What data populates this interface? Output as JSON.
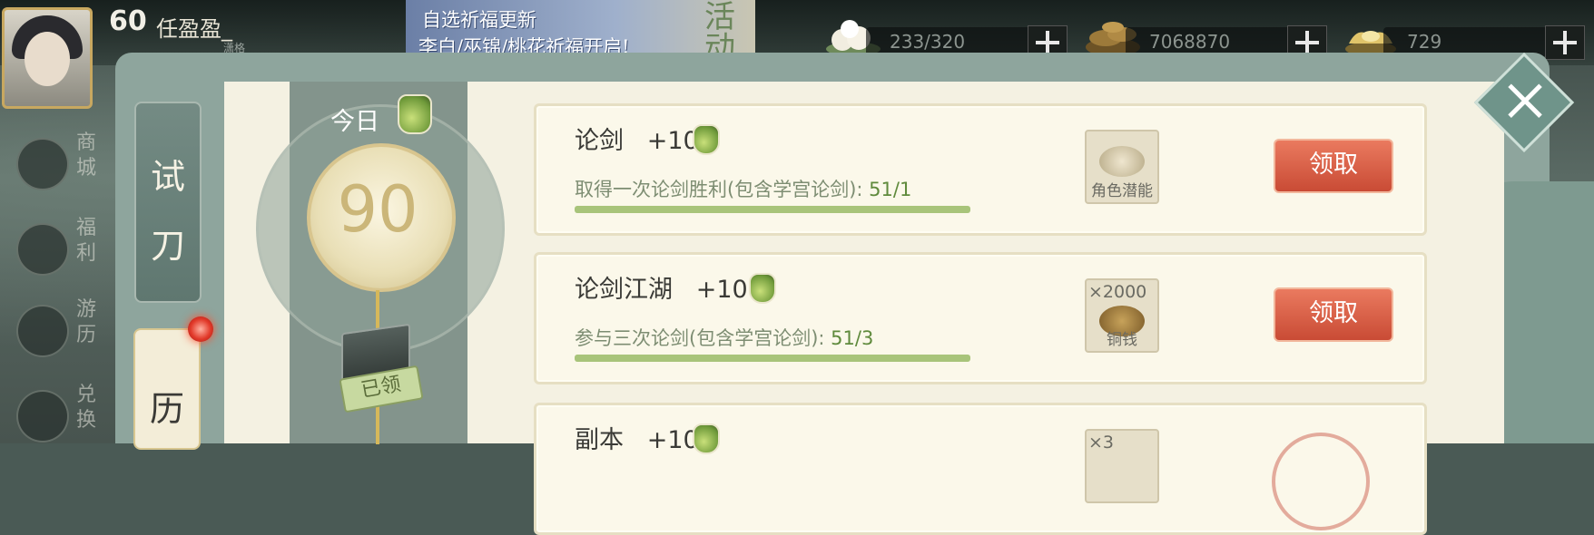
{
  "player": {
    "level": "60",
    "name": "任盈盈_",
    "subtitle": "潇格"
  },
  "banner": {
    "line1": "自选祈福更新",
    "line2": "李白/巫锦/桃花祈福开启!",
    "tag": "活动"
  },
  "resources": [
    {
      "icon": "bun-icon",
      "value": "233/320"
    },
    {
      "icon": "coin-pile-icon",
      "value": "7068870"
    },
    {
      "icon": "gold-ingot-icon",
      "value": "729"
    }
  ],
  "left_nav": [
    {
      "name": "shop",
      "label": "商城"
    },
    {
      "name": "welfare",
      "label": "福利"
    },
    {
      "name": "journey",
      "label": "游历"
    },
    {
      "name": "exchange",
      "label": "兑换"
    }
  ],
  "tabs": [
    {
      "label_top": "试",
      "label_bottom": "刀"
    },
    {
      "label_top": "历"
    }
  ],
  "progress": {
    "today_label": "今日",
    "score": "90",
    "claimed_label": "已领"
  },
  "tasks": [
    {
      "title": "论剑",
      "points": "+10",
      "desc": "取得一次论剑胜利(包含学宫论剑):",
      "progress": "51/1",
      "progress_fraction": 1.0,
      "reward_label": "角色潜能",
      "reward_count": "",
      "button": "领取"
    },
    {
      "title": "论剑江湖",
      "points": "+10",
      "desc": "参与三次论剑(包含学宫论剑):",
      "progress": "51/3",
      "progress_fraction": 1.0,
      "reward_label": "铜钱",
      "reward_count": "×2000",
      "button": "领取"
    },
    {
      "title": "副本",
      "points": "+10",
      "reward_count": "×3"
    }
  ]
}
